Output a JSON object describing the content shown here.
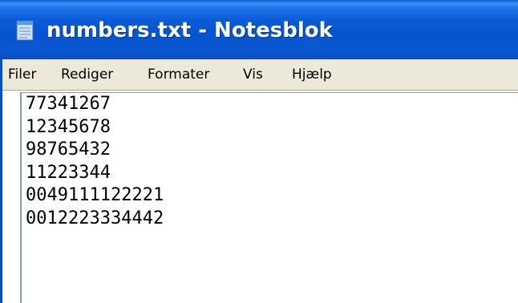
{
  "window": {
    "title": "numbers.txt - Notesblok",
    "icon": "notepad-icon"
  },
  "menubar": {
    "items": [
      {
        "label": "Filer"
      },
      {
        "label": "Rediger"
      },
      {
        "label": "Formater"
      },
      {
        "label": "Vis"
      },
      {
        "label": "Hjælp"
      }
    ]
  },
  "editor": {
    "lines": [
      "77341267",
      "12345678",
      "98765432",
      "11223344",
      "0049111122221",
      "0012223334442"
    ]
  },
  "colors": {
    "titlebar": "#0553cf",
    "menubar": "#ece9d8",
    "editor_border": "#7f9db9"
  }
}
